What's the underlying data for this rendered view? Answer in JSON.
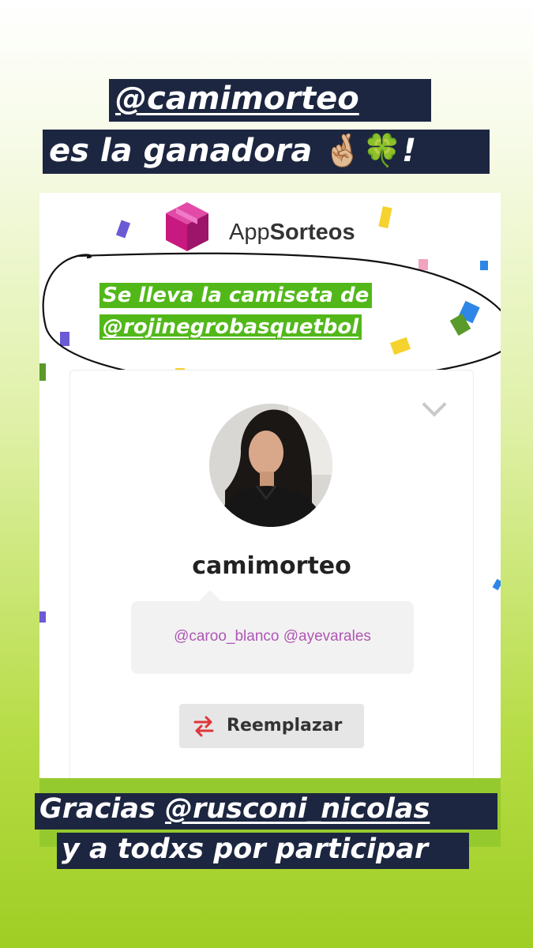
{
  "header": {
    "mention": "@camimorteo",
    "winner_line": "es la ganadora",
    "winner_emojis": "🤞🏼🍀",
    "winner_suffix": "!"
  },
  "app": {
    "brand_prefix": "App",
    "brand_suffix": "Sorteos",
    "logo_icon": "gift-box-icon",
    "prize_line1": "Se lleva la camiseta de",
    "prize_line2": "@rojinegrobasquetbol",
    "winner_card": {
      "username": "camimorteo",
      "mentions": "@caroo_blanco @ayevarales",
      "replace_label": "Reemplazar",
      "chevron_icon": "chevron-down-icon",
      "replace_icon": "swap-arrows-icon"
    }
  },
  "footer": {
    "thanks_prefix": "Gracias",
    "thanks_mention": "@rusconi_nicolas",
    "thanks_line2": "y a todxs por participar"
  },
  "colors": {
    "sticker_bg": "#1c2640",
    "prize_highlight": "#52b81a",
    "logo_magenta": "#c7197f",
    "mention_purple": "#b055b5",
    "replace_red": "#e0353a"
  }
}
